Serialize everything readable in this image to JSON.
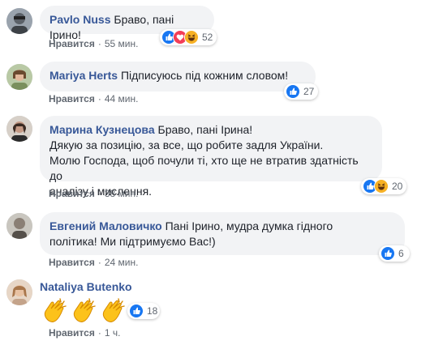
{
  "comments": [
    {
      "author": "Pavlo Nuss",
      "text": "Браво, пані Ірино!",
      "like_label": "Нравится",
      "time": "55 мин.",
      "reactions": [
        "like",
        "love",
        "haha"
      ],
      "reaction_count": "52"
    },
    {
      "author": "Mariya Herts",
      "text": "Підписуюсь під кожним словом!",
      "like_label": "Нравится",
      "time": "44 мин.",
      "reactions": [
        "like"
      ],
      "reaction_count": "27"
    },
    {
      "author": "Марина Кузнецова",
      "text_lines": [
        "Браво, пані Ірина!",
        "Дякую за позицію, за все, що робите задля України.",
        "Молю Господа, щоб почули ті, хто ще не втратив здатність до",
        "аналізу і мислення."
      ],
      "like_label": "Нравится",
      "time": "38 мин.",
      "reactions": [
        "like",
        "haha"
      ],
      "reaction_count": "20"
    },
    {
      "author": "Евгений Маловичко",
      "text_lines": [
        "Пані Ірино, мудра думка гідного",
        "політика! Ми підтримуємо Вас!)"
      ],
      "like_label": "Нравится",
      "time": "24 мин.",
      "reactions": [
        "like"
      ],
      "reaction_count": "6"
    },
    {
      "author": "Nataliya Butenko",
      "emoji": [
        "clapping-hands",
        "clapping-hands",
        "clapping-hands"
      ],
      "like_label": "Нравится",
      "time": "1 ч.",
      "reactions": [
        "like"
      ],
      "reaction_count": "18"
    }
  ],
  "colors": {
    "author": "#385898",
    "bubble": "#f2f3f5",
    "meta": "#606770",
    "like_blue": "#1877f2",
    "love_red": "#f33e58",
    "haha_yellow": "#f7b125"
  }
}
